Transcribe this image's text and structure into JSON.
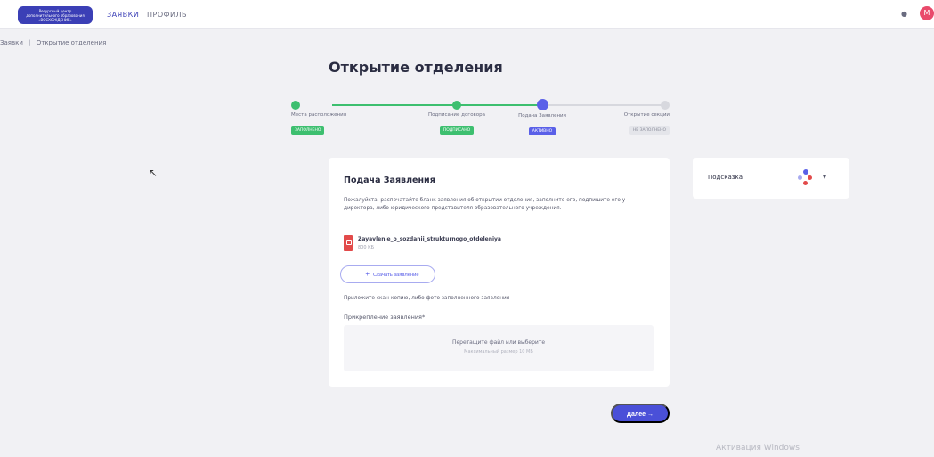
{
  "header": {
    "logo_text": "Ресурсный центр\nдополнительного образования\n«ВОСХОЖДЕНИЕ»",
    "nav": [
      "ЗАЯВКИ",
      "ПРОФИЛЬ"
    ],
    "bell_icon": "bell-icon",
    "avatar_initial": "М"
  },
  "breadcrumb": {
    "items": [
      "Заявки",
      "Открытие отделения"
    ],
    "separator": "|"
  },
  "page": {
    "title": "Открытие отделения"
  },
  "stepper": {
    "steps": [
      {
        "label": "Места расположения",
        "badge": "ЗАПОЛНЕНО",
        "state": "done"
      },
      {
        "label": "Подписание договора",
        "badge": "ПОДПИСАНО",
        "state": "done"
      },
      {
        "label": "Подача Заявления",
        "badge": "АКТИВНО",
        "state": "current"
      },
      {
        "label": "Открытие секции",
        "badge": "НЕ ЗАПОЛНЕНО",
        "state": "pending"
      }
    ]
  },
  "card": {
    "title": "Подача Заявления",
    "description": "Пожалуйста, распечатайте бланк заявления об открытии отделения, заполните его, подпишите его у директора, либо юридического представителя образовательного учреждения.",
    "file_name": "Zayavlenie_o_sozdanii_strukturnogo_otdeleniya",
    "file_size": "800 КБ",
    "download_label": "Скачать заявление",
    "attach_description": "Приложите скан-копию, либо фото заполненного заявления",
    "field_label": "Прикрепление заявления*",
    "dropzone_main": "Перетащите файл или выберите",
    "dropzone_sub": "Максимальный размер 10 МБ"
  },
  "hint": {
    "label": "Подсказка"
  },
  "next_button": {
    "label": "Далее  →"
  },
  "watermark": "Активация Windows",
  "colors": {
    "accent": "#4a50d8",
    "success": "#3dbf6f",
    "background": "#f1f1f4",
    "file_icon": "#e24a4a"
  }
}
